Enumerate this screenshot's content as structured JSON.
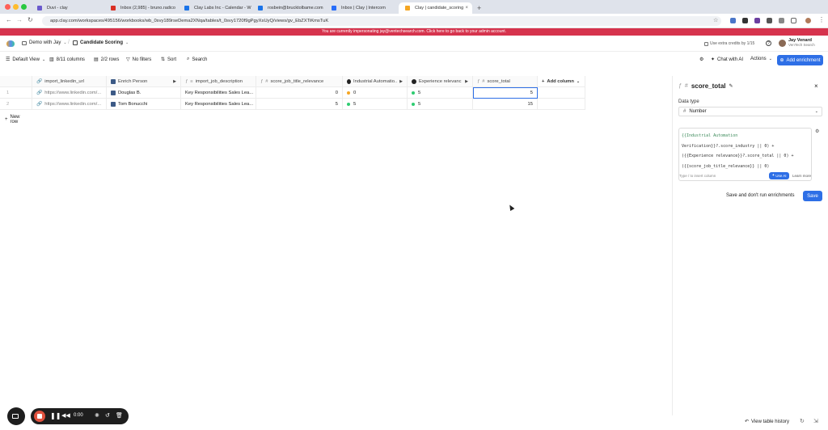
{
  "browser": {
    "tabs": [
      {
        "label": "Duvi - clay",
        "fav_color": "#6a5acd"
      },
      {
        "label": "Inbox (2,985) - bruno.radico",
        "fav_color": "#d93025"
      },
      {
        "label": "Clay Labs Inc - Calendar - W",
        "fav_color": "#1a73e8"
      },
      {
        "label": "rosbein@brucktolbame.com",
        "fav_color": "#1a73e8"
      },
      {
        "label": "Inbox | Clay | Intercom",
        "fav_color": "#286efa"
      },
      {
        "label": "Clay | candidate_scoring",
        "fav_color": "#f5a623"
      }
    ],
    "new_tab": "+",
    "url": "app.clay.com/workspaces/495156/workbooks/wb_0svy189rseDema2XNqa/tables/t_0svy1720f9gPgyXsUyQ/views/gv_EbZXTiKmsTuK"
  },
  "banner": {
    "text": "You are currently impersonating jay@ventechsearch.com. Click here to go back to your admin account."
  },
  "header": {
    "workspace": "Demo with Jay",
    "table_name": "Candidate Scoring",
    "credits": "Use extra credits by 1/15",
    "user_name": "Jay Venard",
    "user_org": "VenTech Search"
  },
  "toolbar": {
    "view": "Default View",
    "columns": "8/11 columns",
    "rows": "2/2 rows",
    "filters": "No filters",
    "sort": "Sort",
    "search": "Search",
    "chat": "Chat with AI",
    "actions": "Actions",
    "add_enrichment": "Add enrichment"
  },
  "grid": {
    "columns": [
      "import_linkedin_url",
      "Enrich Person",
      "import_job_description",
      "score_job_title_relevance",
      "Industrial Automatio..",
      "Experience relevanc",
      "score_total"
    ],
    "add_column": "Add column",
    "rows": [
      {
        "idx": "1",
        "url": "https://www.linkedin.com/...",
        "person": "Douglas B.",
        "desc": "Key Responsibilities Sales Lea...",
        "title_score": "0",
        "industry": "0",
        "industry_color": "#f5a623",
        "experience": "5",
        "experience_color": "#2ecc71",
        "total": "5"
      },
      {
        "idx": "2",
        "url": "https://www.linkedin.com/...",
        "person": "Tom Bonucchi",
        "desc": "Key Responsibilities Sales Lea...",
        "title_score": "5",
        "industry": "5",
        "industry_color": "#2ecc71",
        "experience": "5",
        "experience_color": "#2ecc71",
        "total": "15"
      }
    ],
    "new_row": "New row"
  },
  "panel": {
    "title": "score_total",
    "data_type_label": "Data type",
    "data_type_value": "Number",
    "formula_lines": [
      "{{Industrial Automation",
      "Verification}}?.score_industry || 0) +",
      "({{Experience relevance}}?.score_total || 0) +",
      "({{score_job_title_relevance}} || 0)"
    ],
    "formula_hint": "Type / to insert column",
    "use_ai": "Use AI",
    "learn_more": "Learn more",
    "save_no_run": "Save and don't run enrichments",
    "save": "Save"
  },
  "recorder": {
    "time": "0:00"
  },
  "footer": {
    "history": "View table history"
  }
}
